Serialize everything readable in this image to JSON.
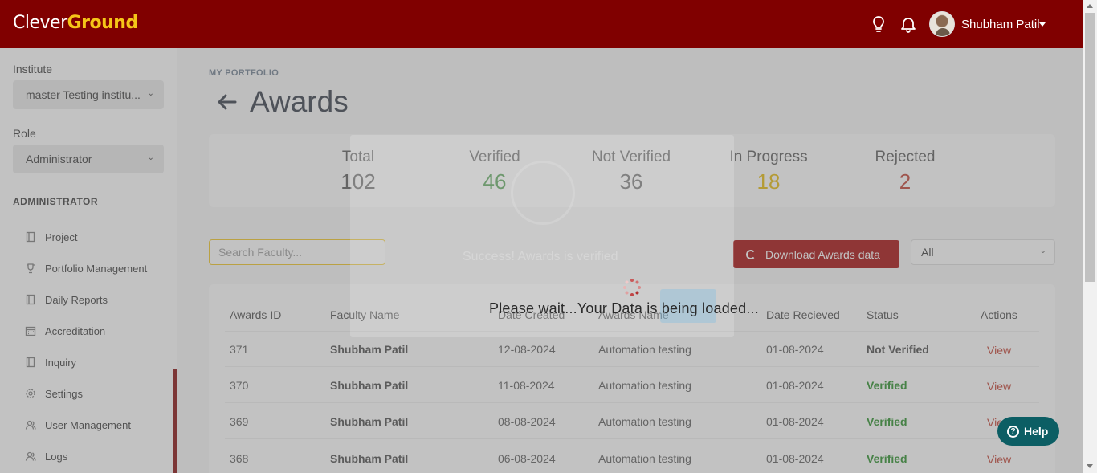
{
  "header": {
    "logo_part1": "Clever",
    "logo_part2": "Ground",
    "user_name": "Shubham Patil",
    "icons": [
      "lightbulb-icon",
      "bell-icon"
    ],
    "accent_color": "#800000"
  },
  "sidebar": {
    "institute_label": "Institute",
    "institute_value": "master Testing institu...",
    "role_label": "Role",
    "role_value": "Administrator",
    "section_title": "ADMINISTRATOR",
    "items": [
      {
        "label": "Project",
        "icon": "book-icon"
      },
      {
        "label": "Portfolio Management",
        "icon": "trophy-icon"
      },
      {
        "label": "Daily Reports",
        "icon": "book-icon"
      },
      {
        "label": "Accreditation",
        "icon": "calendar-icon"
      },
      {
        "label": "Inquiry",
        "icon": "book-icon"
      },
      {
        "label": "Settings",
        "icon": "gear-icon"
      },
      {
        "label": "User Management",
        "icon": "users-icon"
      },
      {
        "label": "Logs",
        "icon": "users-icon"
      }
    ]
  },
  "page": {
    "breadcrumb": "MY PORTFOLIO",
    "title": "Awards"
  },
  "stats": [
    {
      "label": "Total",
      "value": "102",
      "color": "#555555"
    },
    {
      "label": "Verified",
      "value": "46",
      "color": "#2e8b2e"
    },
    {
      "label": "Not Verified",
      "value": "36",
      "color": "#555555"
    },
    {
      "label": "In Progress",
      "value": "18",
      "color": "#e6b800"
    },
    {
      "label": "Rejected",
      "value": "2",
      "color": "#c0392b"
    }
  ],
  "toolbar": {
    "search_placeholder": "Search Faculty...",
    "download_label": "Download Awards data",
    "filter_value": "All"
  },
  "table": {
    "columns": [
      "Awards ID",
      "Faculty Name",
      "Date Created",
      "Awards Name",
      "Date Recieved",
      "Status",
      "Actions"
    ],
    "rows": [
      {
        "id": "371",
        "faculty": "Shubham Patil",
        "created": "12-08-2024",
        "name": "Automation testing",
        "received": "01-08-2024",
        "status": "Not Verified",
        "action": "View"
      },
      {
        "id": "370",
        "faculty": "Shubham Patil",
        "created": "11-08-2024",
        "name": "Automation testing",
        "received": "01-08-2024",
        "status": "Verified",
        "action": "View"
      },
      {
        "id": "369",
        "faculty": "Shubham Patil",
        "created": "08-08-2024",
        "name": "Automation testing",
        "received": "01-08-2024",
        "status": "Verified",
        "action": "View"
      },
      {
        "id": "368",
        "faculty": "Shubham Patil",
        "created": "06-08-2024",
        "name": "Automation testing",
        "received": "01-08-2024",
        "status": "Verified",
        "action": "View"
      }
    ]
  },
  "overlay": {
    "ghost_message": "Success! Awards is verified",
    "loading_text": "Please wait...Your Data is being loaded..."
  },
  "help": {
    "label": "Help"
  }
}
